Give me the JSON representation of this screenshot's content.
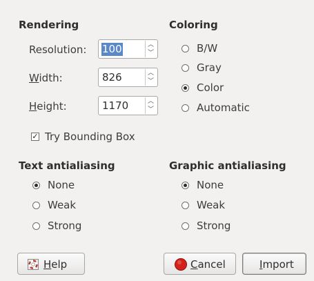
{
  "rendering": {
    "title": "Rendering",
    "resolution": {
      "label": "Resolution:",
      "value": "100"
    },
    "width": {
      "label_mnemonic": "W",
      "label_rest": "idth:",
      "value": "826"
    },
    "height": {
      "label_mnemonic": "H",
      "label_rest": "eight:",
      "value": "1170"
    },
    "bounding_box": {
      "label": "Try Bounding Box",
      "checked": true
    }
  },
  "coloring": {
    "title": "Coloring",
    "options": [
      {
        "label": "B/W",
        "selected": false
      },
      {
        "label": "Gray",
        "selected": false
      },
      {
        "label": "Color",
        "selected": true
      },
      {
        "label": "Automatic",
        "selected": false
      }
    ]
  },
  "text_antialiasing": {
    "title": "Text antialiasing",
    "options": [
      {
        "label": "None",
        "selected": true
      },
      {
        "label": "Weak",
        "selected": false
      },
      {
        "label": "Strong",
        "selected": false
      }
    ]
  },
  "graphic_antialiasing": {
    "title": "Graphic antialiasing",
    "options": [
      {
        "label": "None",
        "selected": true
      },
      {
        "label": "Weak",
        "selected": false
      },
      {
        "label": "Strong",
        "selected": false
      }
    ]
  },
  "buttons": {
    "help": {
      "mnemonic": "H",
      "rest": "elp",
      "icon": "help-lifebuoy-icon"
    },
    "cancel": {
      "mnemonic": "C",
      "rest": "ancel",
      "icon": "cancel-stop-icon"
    },
    "import": {
      "mnemonic": "I",
      "rest": "mport"
    }
  }
}
